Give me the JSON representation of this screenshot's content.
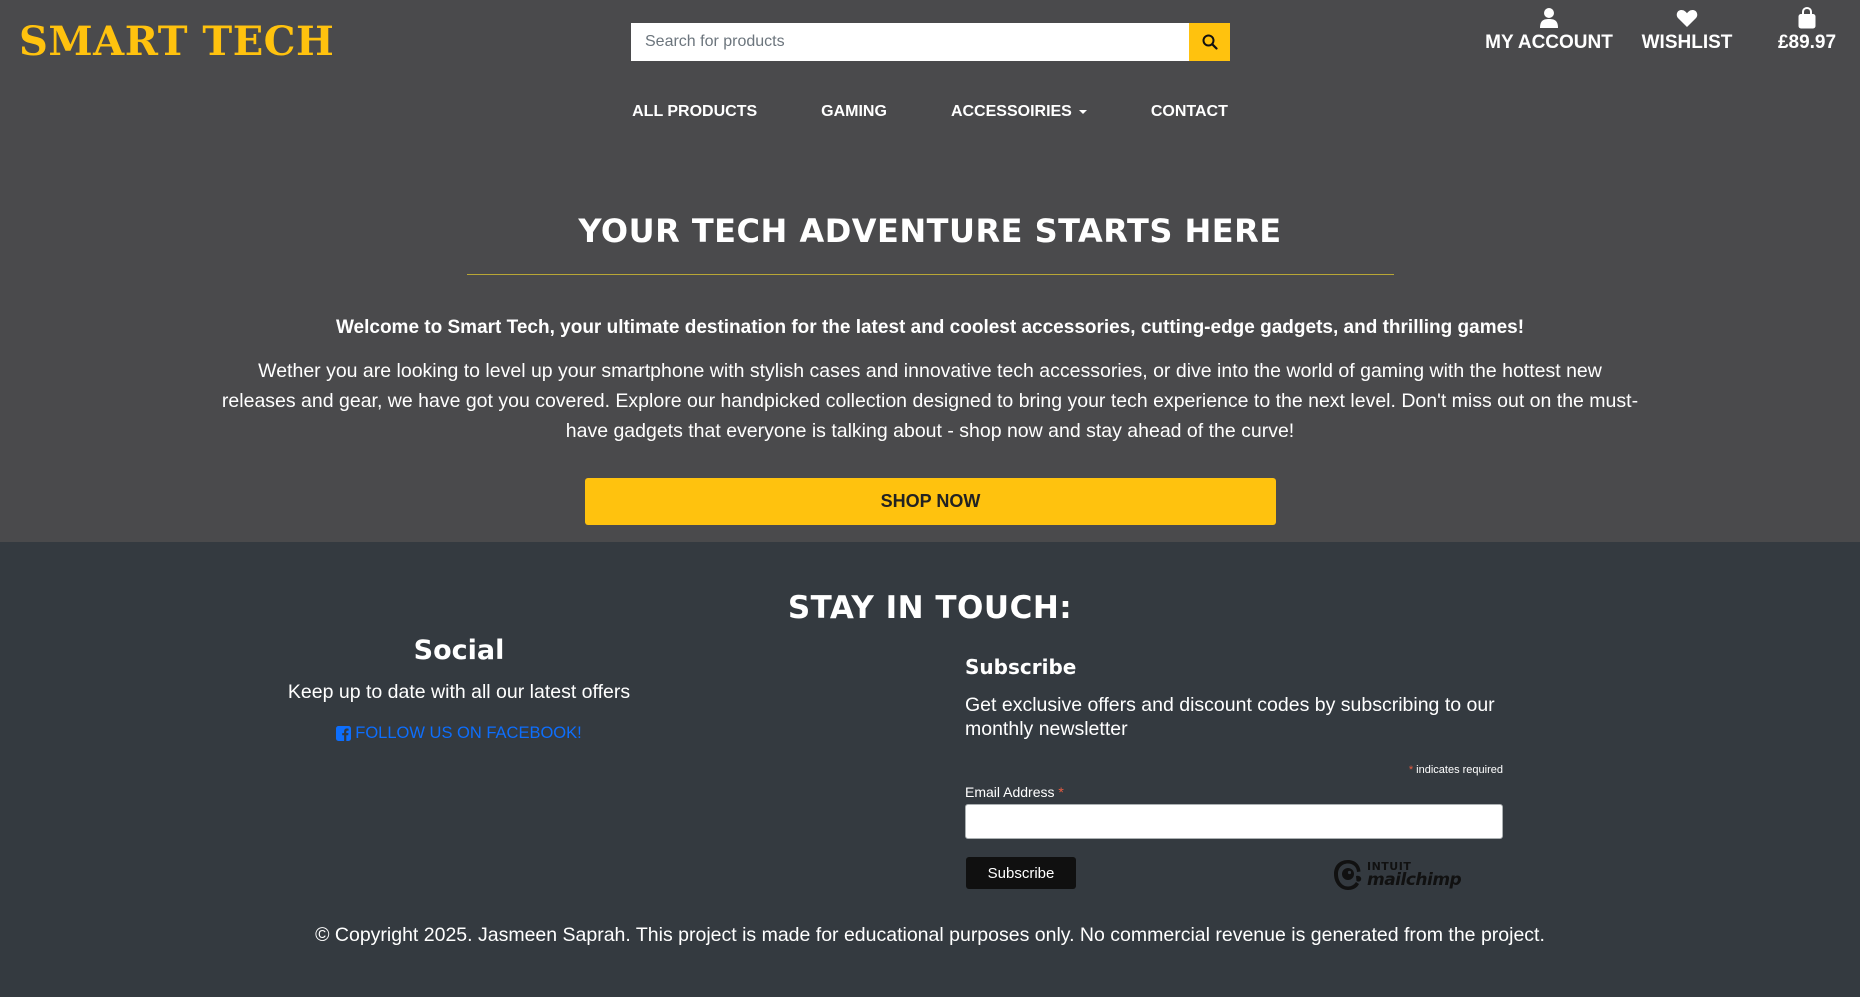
{
  "header": {
    "brand": "SMART TECH",
    "search": {
      "placeholder": "Search for products",
      "value": ""
    },
    "account_label": "MY ACCOUNT",
    "wishlist_label": "WISHLIST",
    "cart_total": "£89.97"
  },
  "nav": {
    "all_products": "ALL PRODUCTS",
    "gaming": "GAMING",
    "accessoires": "ACCESSOIRIES",
    "contact": "CONTACT"
  },
  "hero": {
    "title": "YOUR TECH ADVENTURE STARTS HERE",
    "lead": "Welcome to Smart Tech, your ultimate destination for the latest and coolest accessories, cutting-edge gadgets, and thrilling games!",
    "body": "Wether you are looking to level up your smartphone with stylish cases and innovative tech accessories, or dive into the world of gaming with the hottest new releases and gear, we have got you covered. Explore our handpicked collection designed to bring your tech experience to the next level. Don't miss out on the must-have gadgets that everyone is talking about - shop now and stay ahead of the curve!",
    "cta": "SHOP NOW"
  },
  "footer": {
    "title": "STAY IN TOUCH:",
    "social": {
      "title": "Social",
      "text": "Keep up to date with all our latest offers",
      "facebook_link": "FOLLOW US ON FACEBOOK!"
    },
    "subscribe": {
      "title": "Subscribe",
      "text": "Get exclusive offers and discount codes by subscribing to our monthly newsletter",
      "required_star": "*",
      "required_note": "indicates required",
      "email_label": "Email Address",
      "email_value": "",
      "button": "Subscribe",
      "logo_top": "INTUIT",
      "logo_name": "mailchimp"
    },
    "copyright": "© Copyright 2025. Jasmeen Saprah. This project is made for educational purposes only. No commercial revenue is generated from the project."
  },
  "colors": {
    "accent": "#ffc20e",
    "header_bg": "#4a4a4c",
    "footer_bg": "#343a40",
    "link": "#0d6efd"
  },
  "icons": {
    "search": "search-icon",
    "account": "user-icon",
    "wishlist": "heart-icon",
    "cart": "shopping-bag-icon",
    "dropdown": "caret-down-icon",
    "facebook": "facebook-square-icon",
    "mailchimp": "mailchimp-logo"
  }
}
